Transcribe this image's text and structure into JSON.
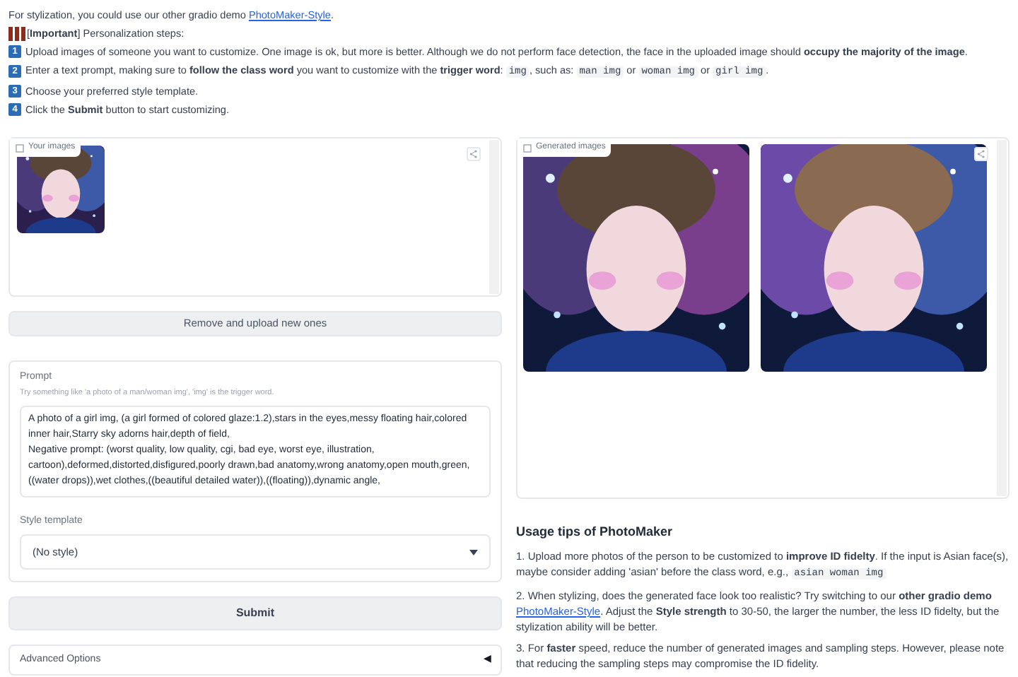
{
  "intro": {
    "before": "For stylization, you could use our other gradio demo ",
    "link": "PhotoMaker-Style",
    "after": "."
  },
  "important": "[**Important**] Personalization steps:",
  "steps": [
    {
      "number": "1",
      "parts": [
        {
          "kind": "text",
          "text": "Upload images of someone you want to customize. One image is ok, but more is better. Although we do not perform face detection, the face in the uploaded image should **occupy the majority of the image**."
        }
      ]
    },
    {
      "number": "2",
      "parts": [
        {
          "kind": "text",
          "text": "Enter a text prompt, making sure to **follow the class word** you want to customize with the **trigger word**: "
        },
        {
          "kind": "code",
          "text": "img"
        },
        {
          "kind": "text",
          "text": ", such as: "
        },
        {
          "kind": "code",
          "text": "man img"
        },
        {
          "kind": "text",
          "text": " or "
        },
        {
          "kind": "code",
          "text": "woman img"
        },
        {
          "kind": "text",
          "text": " or "
        },
        {
          "kind": "code",
          "text": "girl img"
        },
        {
          "kind": "text",
          "text": "."
        }
      ]
    },
    {
      "number": "3",
      "parts": [
        {
          "kind": "text",
          "text": "Choose your preferred style template."
        }
      ]
    },
    {
      "number": "4",
      "parts": [
        {
          "kind": "text",
          "text": "Click the **Submit** button to start customizing."
        }
      ]
    }
  ],
  "your_images": {
    "label": "Your images"
  },
  "remove_button": "Remove and upload new ones",
  "prompt": {
    "label": "Prompt",
    "hint": "Try something like 'a photo of a man/woman img', 'img' is the trigger word.",
    "value": "A photo of a girl img, (a girl formed of colored glaze:1.2),stars in the eyes,messy floating hair,colored inner hair,Starry sky adorns hair,depth of field,\nNegative prompt: (worst quality, low quality, cgi, bad eye, worst eye, illustration, cartoon),deformed,distorted,disfigured,poorly drawn,bad anatomy,wrong anatomy,open mouth,green,((water drops)),wet clothes,((beautiful detailed water)),((floating)),dynamic angle,"
  },
  "style_template": {
    "label": "Style template",
    "value": "(No style)"
  },
  "submit_button": "Submit",
  "advanced_options": {
    "label": "Advanced Options",
    "caret": "◀",
    "expanded": false
  },
  "generated_images": {
    "label": "Generated images"
  },
  "usage_tips": {
    "title": "Usage tips of PhotoMaker",
    "tips": [
      [
        {
          "kind": "text",
          "text": "1. Upload more photos of the person to be customized to **improve ID fidelty**. If the input is Asian face(s), maybe consider adding 'asian' before the class word, e.g., "
        },
        {
          "kind": "code",
          "text": "asian woman img"
        }
      ],
      [
        {
          "kind": "text",
          "text": "2. When stylizing, does the generated face look too realistic? Try switching to our **other gradio demo** "
        },
        {
          "kind": "link",
          "text": "PhotoMaker-Style"
        },
        {
          "kind": "text",
          "text": ". Adjust the **Style strength** to 30-50, the larger the number, the less ID fidelty, but the stylization ability will be better."
        }
      ],
      [
        {
          "kind": "text",
          "text": "3. For **faster** speed, reduce the number of generated images and sampling steps. However, please note that reducing the sampling steps may compromise the ID fidelity."
        }
      ]
    ]
  }
}
